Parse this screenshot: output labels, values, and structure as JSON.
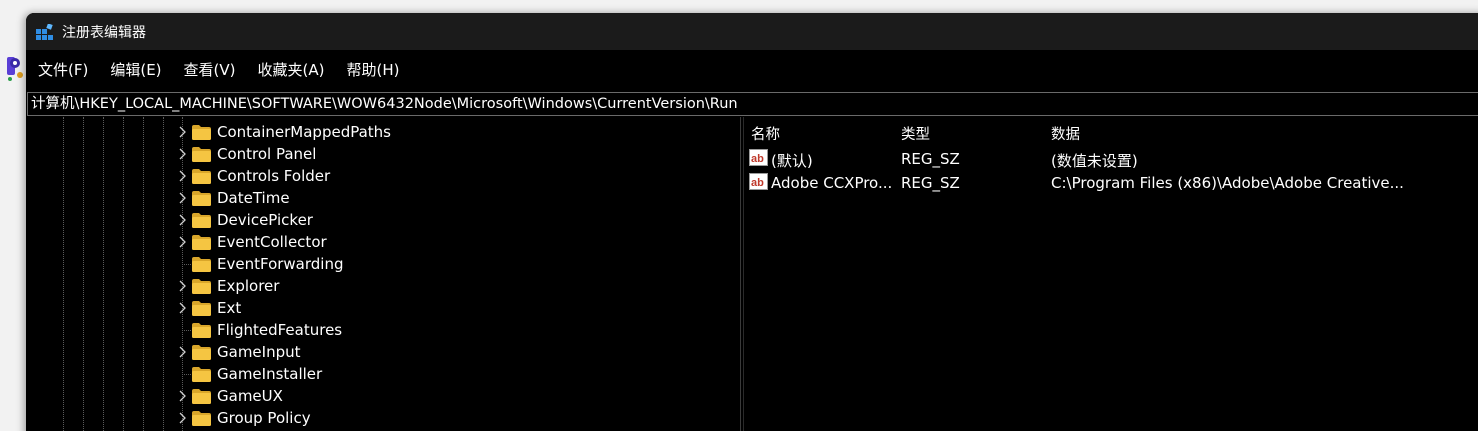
{
  "window": {
    "title": "注册表编辑器"
  },
  "menu": {
    "file": "文件(F)",
    "edit": "编辑(E)",
    "view": "查看(V)",
    "favorites": "收藏夹(A)",
    "help": "帮助(H)"
  },
  "address": {
    "path": "计算机\\HKEY_LOCAL_MACHINE\\SOFTWARE\\WOW6432Node\\Microsoft\\Windows\\CurrentVersion\\Run"
  },
  "tree": {
    "items": [
      {
        "label": "ContainerMappedPaths",
        "expandable": true
      },
      {
        "label": "Control Panel",
        "expandable": true
      },
      {
        "label": "Controls Folder",
        "expandable": true
      },
      {
        "label": "DateTime",
        "expandable": true
      },
      {
        "label": "DevicePicker",
        "expandable": true
      },
      {
        "label": "EventCollector",
        "expandable": true
      },
      {
        "label": "EventForwarding",
        "expandable": false
      },
      {
        "label": "Explorer",
        "expandable": true
      },
      {
        "label": "Ext",
        "expandable": true
      },
      {
        "label": "FlightedFeatures",
        "expandable": false
      },
      {
        "label": "GameInput",
        "expandable": true
      },
      {
        "label": "GameInstaller",
        "expandable": false
      },
      {
        "label": "GameUX",
        "expandable": true
      },
      {
        "label": "Group Policy",
        "expandable": true
      }
    ]
  },
  "list": {
    "headers": {
      "name": "名称",
      "type": "类型",
      "data": "数据"
    },
    "rows": [
      {
        "name": "(默认)",
        "type": "REG_SZ",
        "data": "(数值未设置)"
      },
      {
        "name": "Adobe CCXPro...",
        "type": "REG_SZ",
        "data": "C:\\Program Files (x86)\\Adobe\\Adobe Creative..."
      }
    ]
  },
  "colors": {
    "folder": "#f5c542",
    "folder_dark": "#d9a62a",
    "value_icon": "#c0392b",
    "titlebar": "#1b1b1b",
    "background": "#000000"
  },
  "icons": {
    "app": "registry-editor-icon",
    "folder": "folder-icon",
    "value": "string-value-icon",
    "expand": "chevron-right-icon"
  }
}
